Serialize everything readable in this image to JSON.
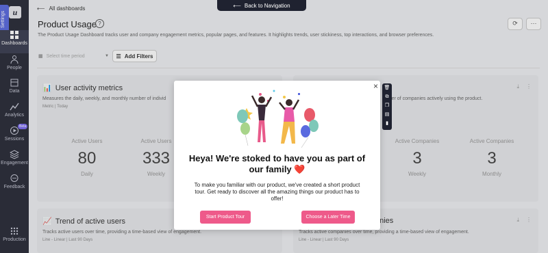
{
  "sidebar": {
    "logo": "u",
    "settings_tab": "Settings",
    "items": [
      {
        "label": "Dashboards",
        "icon": "dashboard-icon"
      },
      {
        "label": "People",
        "icon": "people-icon"
      },
      {
        "label": "Data",
        "icon": "data-icon"
      },
      {
        "label": "Analytics",
        "icon": "analytics-icon"
      },
      {
        "label": "Sessions",
        "icon": "sessions-icon",
        "badge": "Beta"
      },
      {
        "label": "Engagement",
        "icon": "engagement-icon"
      },
      {
        "label": "Feedback",
        "icon": "feedback-icon"
      },
      {
        "label": "Production",
        "icon": "production-icon"
      }
    ]
  },
  "header": {
    "back_label": "All dashboards",
    "nav_button": "Back to Navigation",
    "title": "Product Usage",
    "description": "The Product Usage Dashboard tracks user and company engagement metrics, popular pages, and features. It highlights trends, user stickiness, top interactions, and browser preferences."
  },
  "filters": {
    "time_placeholder": "Select time period",
    "add_filters": "Add Filters"
  },
  "cards": {
    "user_activity": {
      "title": "User activity metrics",
      "desc": "Measures the daily, weekly, and monthly number of individ",
      "meta": "Metric | Today",
      "stats": [
        {
          "label": "Active Users",
          "value": "80",
          "period": "Daily"
        },
        {
          "label": "Active Users",
          "value": "333",
          "period": "Weekly"
        }
      ]
    },
    "company_activity": {
      "desc": "umber of companies actively using the product.",
      "stats": [
        {
          "label": "Active Companies",
          "value": "3",
          "period": "Weekly"
        },
        {
          "label": "Active Companies",
          "value": "3",
          "period": "Monthly"
        }
      ]
    },
    "trend_users": {
      "title": "Trend of active users",
      "desc": "Tracks active users over time, providing a time-based view of engagement.",
      "meta": "Line - Linear | Last 90 Days"
    },
    "trend_companies": {
      "title_partial": "anies",
      "desc": "Tracks active companies over time, providing a time-based view of engagement.",
      "meta": "Line - Linear | Last 90 Days"
    }
  },
  "modal": {
    "title": "Heya! We're stoked to have you as part of our family ❤️",
    "body": "To make you familiar with our product, we've created a short product tour. Get ready to discover all the amazing things our product has to offer!",
    "primary_button": "Start Product Tour",
    "secondary_button": "Choose a Later Time",
    "close": "×"
  },
  "colors": {
    "sidebar_bg": "#2b2d3a",
    "accent": "#ee5a8a",
    "settings_tab": "#5a6adf"
  }
}
